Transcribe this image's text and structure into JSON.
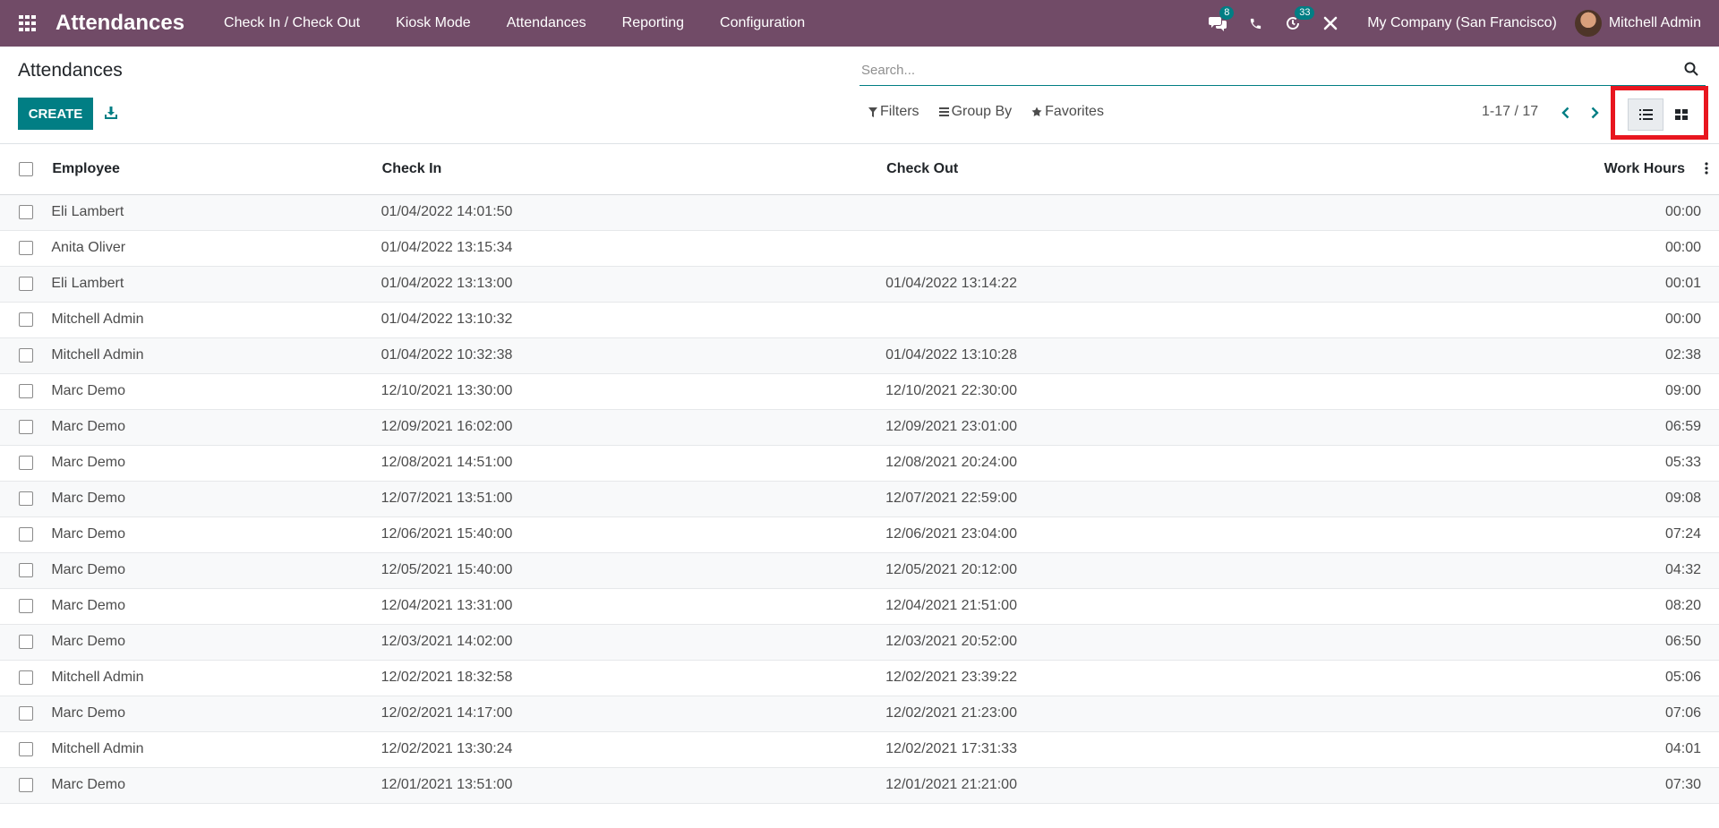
{
  "header": {
    "app_title": "Attendances",
    "menu": [
      "Check In / Check Out",
      "Kiosk Mode",
      "Attendances",
      "Reporting",
      "Configuration"
    ],
    "messages_badge": "8",
    "activities_badge": "33",
    "company": "My Company (San Francisco)",
    "user": "Mitchell Admin"
  },
  "control_panel": {
    "title": "Attendances",
    "create_label": "CREATE",
    "search_placeholder": "Search...",
    "filters_label": "Filters",
    "group_by_label": "Group By",
    "favorites_label": "Favorites",
    "pager": "1-17 / 17"
  },
  "table": {
    "columns": [
      "Employee",
      "Check In",
      "Check Out",
      "Work Hours"
    ],
    "rows": [
      [
        "Eli Lambert",
        "01/04/2022 14:01:50",
        "",
        "00:00"
      ],
      [
        "Anita Oliver",
        "01/04/2022 13:15:34",
        "",
        "00:00"
      ],
      [
        "Eli Lambert",
        "01/04/2022 13:13:00",
        "01/04/2022 13:14:22",
        "00:01"
      ],
      [
        "Mitchell Admin",
        "01/04/2022 13:10:32",
        "",
        "00:00"
      ],
      [
        "Mitchell Admin",
        "01/04/2022 10:32:38",
        "01/04/2022 13:10:28",
        "02:38"
      ],
      [
        "Marc Demo",
        "12/10/2021 13:30:00",
        "12/10/2021 22:30:00",
        "09:00"
      ],
      [
        "Marc Demo",
        "12/09/2021 16:02:00",
        "12/09/2021 23:01:00",
        "06:59"
      ],
      [
        "Marc Demo",
        "12/08/2021 14:51:00",
        "12/08/2021 20:24:00",
        "05:33"
      ],
      [
        "Marc Demo",
        "12/07/2021 13:51:00",
        "12/07/2021 22:59:00",
        "09:08"
      ],
      [
        "Marc Demo",
        "12/06/2021 15:40:00",
        "12/06/2021 23:04:00",
        "07:24"
      ],
      [
        "Marc Demo",
        "12/05/2021 15:40:00",
        "12/05/2021 20:12:00",
        "04:32"
      ],
      [
        "Marc Demo",
        "12/04/2021 13:31:00",
        "12/04/2021 21:51:00",
        "08:20"
      ],
      [
        "Marc Demo",
        "12/03/2021 14:02:00",
        "12/03/2021 20:52:00",
        "06:50"
      ],
      [
        "Mitchell Admin",
        "12/02/2021 18:32:58",
        "12/02/2021 23:39:22",
        "05:06"
      ],
      [
        "Marc Demo",
        "12/02/2021 14:17:00",
        "12/02/2021 21:23:00",
        "07:06"
      ],
      [
        "Mitchell Admin",
        "12/02/2021 13:30:24",
        "12/02/2021 17:31:33",
        "04:01"
      ],
      [
        "Marc Demo",
        "12/01/2021 13:51:00",
        "12/01/2021 21:21:00",
        "07:30"
      ]
    ]
  },
  "colors": {
    "brand": "#714B67",
    "accent": "#017E84",
    "highlight": "#e8161f"
  },
  "icons": [
    "apps-grid-icon",
    "chat-icon",
    "phone-icon",
    "activity-clock-icon",
    "debug-tools-icon",
    "download-icon",
    "search-icon",
    "filter-icon",
    "group-by-icon",
    "star-icon",
    "chevron-left-icon",
    "chevron-right-icon",
    "list-view-icon",
    "kanban-view-icon",
    "column-options-icon"
  ]
}
